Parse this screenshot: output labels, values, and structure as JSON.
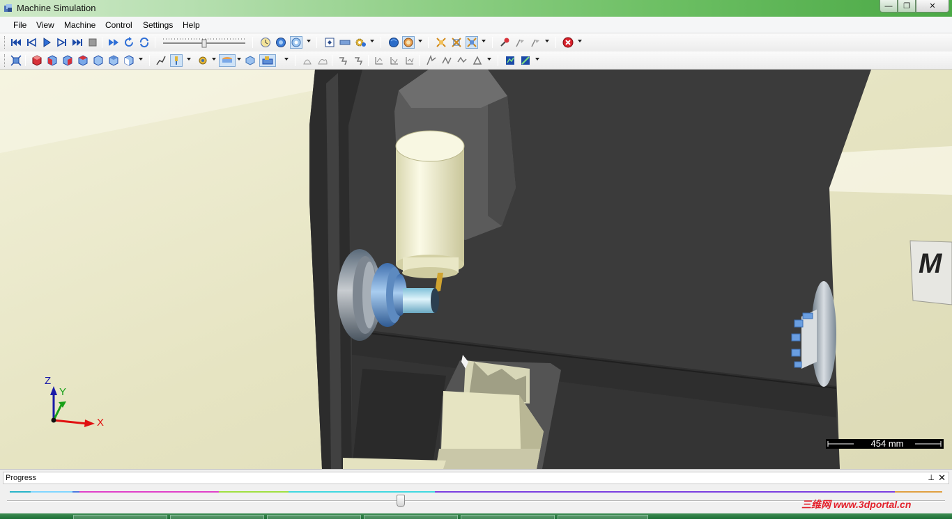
{
  "window": {
    "title": "Machine Simulation",
    "controls": {
      "minimize": "—",
      "maximize": "❐",
      "close": "✕"
    }
  },
  "menu": {
    "items": [
      "File",
      "View",
      "Machine",
      "Control",
      "Settings",
      "Help"
    ]
  },
  "toolbar1": {
    "playback_icons": [
      "rewind-to-start-icon",
      "step-back-icon",
      "play-icon",
      "step-forward-icon",
      "fast-forward-end-icon",
      "stop-icon"
    ],
    "speed_slider_level": 0.5
  },
  "viewport": {
    "axes": {
      "z": "Z",
      "y": "Y",
      "x": "X"
    },
    "machine_label": "M",
    "scale_bar": "454 mm",
    "colors": {
      "background": "#e8e7c9",
      "enclosure": "#3a3a3a",
      "x_axis": "#e01010",
      "y_axis": "#18a018",
      "z_axis": "#1a1aa8"
    }
  },
  "progress": {
    "title": "Progress",
    "pin": "⊥",
    "close": "✕",
    "position": 0.42
  },
  "watermark": "三维网 www.3dportal.cn"
}
